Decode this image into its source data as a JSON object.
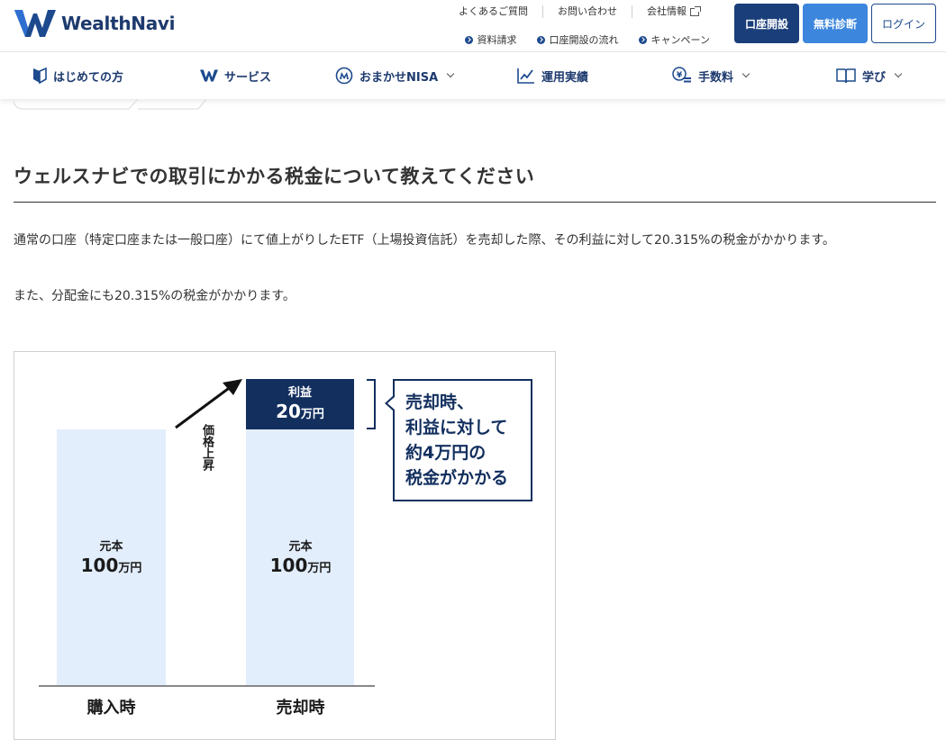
{
  "brand": {
    "name": "WealthNavi",
    "color": "#1d3a6e"
  },
  "header": {
    "util_links": [
      {
        "label": "よくあるご質問"
      },
      {
        "label": "お問い合わせ"
      },
      {
        "label": "会社情報"
      }
    ],
    "sub_links": [
      {
        "label": "資料請求"
      },
      {
        "label": "口座開設の流れ"
      },
      {
        "label": "キャンペーン"
      }
    ],
    "buttons": {
      "open_account": "口座開設",
      "free_diagnosis": "無料診断",
      "login": "ログイン"
    }
  },
  "nav": {
    "items": [
      {
        "label": "はじめての方",
        "icon": "beginner-icon"
      },
      {
        "label": "サービス",
        "icon": "wealthnavi-w-icon"
      },
      {
        "label": "おまかせNISA",
        "icon": "nisa-icon",
        "dropdown": true
      },
      {
        "label": "運用実績",
        "icon": "chart-icon"
      },
      {
        "label": "手数料",
        "icon": "yen-coins-icon",
        "dropdown": true
      },
      {
        "label": "学び",
        "icon": "book-icon",
        "dropdown": true
      }
    ]
  },
  "article": {
    "title": "ウェルスナビでの取引にかかる税金について教えてください",
    "paragraph1": "通常の口座（特定口座または一般口座）にて値上がりしたETF（上場投資信託）を売却した際、その利益に対して20.315%の税金がかかります。",
    "paragraph2": "また、分配金にも20.315%の税金がかかります。"
  },
  "figure": {
    "principal_label": "元本",
    "principal_value": "100",
    "unit": "万円",
    "profit_label": "利益",
    "profit_value": "20",
    "price_rise": "価格上昇",
    "purchase_label": "購入時",
    "sale_label": "売却時",
    "callout": [
      "売却時、",
      "利益に対して",
      "約4万円の",
      "税金がかかる"
    ]
  },
  "colors": {
    "navy": "#122f5e",
    "accent_blue": "#3c86dd",
    "bar_fill": "#e3eefc"
  }
}
